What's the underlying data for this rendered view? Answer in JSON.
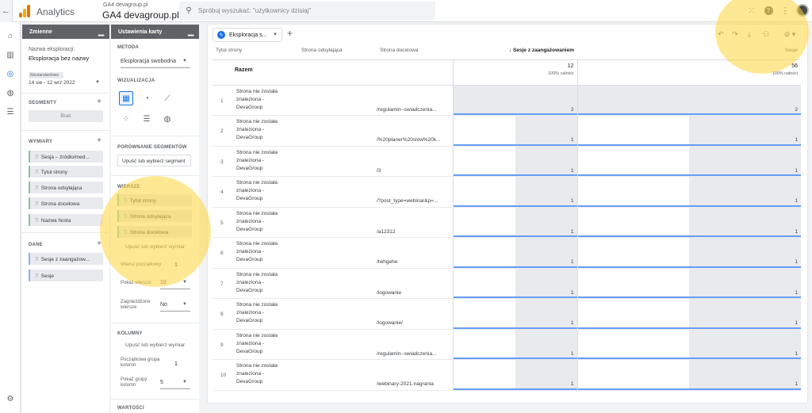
{
  "topbar": {
    "app_name": "Analytics",
    "property_small": "GA4 devagroup.pl",
    "property_big": "GA4 devagroup.pl",
    "search_placeholder": "Spróbuj wyszukać: \"użytkownicy dzisiaj\"",
    "icons": [
      "apps-grid-icon",
      "help-icon",
      "more-vert-icon",
      "avatar"
    ]
  },
  "rail": [
    "home-icon",
    "reports-icon",
    "explore-icon",
    "advertising-icon",
    "configure-icon",
    "settings-icon"
  ],
  "variables": {
    "header": "Zmienne",
    "name_label": "Nazwa eksploracji:",
    "name_value": "Eksploracja bez nazwy",
    "date_custom": "Niestandardowe",
    "date_range": "14 sie - 12 wrz 2022",
    "segments_title": "SEGMENTY",
    "segments_empty": "Brak",
    "dimensions_title": "WYMIARY",
    "dimensions": [
      "Sesja – źródło/med...",
      "Tytuł strony",
      "Strona odsyłająca",
      "Strona docelowa",
      "Nazwa hosta"
    ],
    "metrics_title": "DANE",
    "metrics": [
      "Sesje z zaangażow...",
      "Sesje"
    ]
  },
  "settings": {
    "header": "Ustawienia karty",
    "technique_title": "METODA",
    "technique_value": "Eksploracja swobodna",
    "vis_title": "WIZUALIZACJA",
    "segment_compare_title": "PORÓWNANIE SEGMENTÓW",
    "segment_drop": "Upuść lub wybierz segment",
    "rows_title": "WIERSZE",
    "rows": [
      "Tytuł strony",
      "Strona odsyłająca",
      "Strona docelowa"
    ],
    "rows_drop": "Upuść lub wybierz wymiar",
    "start_row_label": "Wiersz początkowy",
    "start_row_value": "1",
    "show_rows_label": "Pokaż wiersze",
    "show_rows_value": "10",
    "nested_rows_label": "Zagnieżdżone wiersze",
    "nested_rows_value": "No",
    "columns_title": "KOLUMNY",
    "columns_drop": "Upuść lub wybierz wymiar",
    "start_col_label": "Początkowa grupa kolumn",
    "start_col_value": "1",
    "show_cols_label": "Pokaż grupy kolumn",
    "show_cols_value": "5",
    "values_title": "WARTOŚCI"
  },
  "canvas": {
    "tab_label": "Eksploracja s...",
    "headers": [
      "Tytuł strony",
      "Strona odsyłająca",
      "Strona docelowa",
      "↓ Sesje z zaangażowaniem",
      "Sesje"
    ],
    "totals_label": "Razem",
    "totals": [
      {
        "value": "12",
        "pct": "100% całości"
      },
      {
        "value": "56",
        "pct": "100% całości"
      }
    ],
    "rows": [
      {
        "n": "1",
        "title": [
          "Strona nie została",
          "znaleziona -",
          "DevaGroup"
        ],
        "landing": "/regulamin--swiadczenia...",
        "engaged": "2",
        "sessions": "2",
        "engaged_frac": 1,
        "sessions_frac": 1
      },
      {
        "n": "2",
        "title": [
          "Strona nie została",
          "znaleziona -",
          "DevaGroup"
        ],
        "landing": "/%20planer%20slow%20k...",
        "engaged": "1",
        "sessions": "1",
        "engaged_frac": 0.5,
        "sessions_frac": 0.5
      },
      {
        "n": "3",
        "title": [
          "Strona nie została",
          "znaleziona -",
          "DevaGroup"
        ],
        "landing": "/3",
        "engaged": "1",
        "sessions": "1",
        "engaged_frac": 0.5,
        "sessions_frac": 0.5
      },
      {
        "n": "4",
        "title": [
          "Strona nie została",
          "znaleziona -",
          "DevaGroup"
        ],
        "landing": "/?post_type=webinar&p=...",
        "engaged": "1",
        "sessions": "1",
        "engaged_frac": 0.5,
        "sessions_frac": 0.5
      },
      {
        "n": "5",
        "title": [
          "Strona nie została",
          "znaleziona -",
          "DevaGroup"
        ],
        "landing": "/a12312",
        "engaged": "1",
        "sessions": "1",
        "engaged_frac": 0.5,
        "sessions_frac": 0.5
      },
      {
        "n": "6",
        "title": [
          "Strona nie została",
          "znaleziona -",
          "DevaGroup"
        ],
        "landing": "/twhgehe",
        "engaged": "1",
        "sessions": "1",
        "engaged_frac": 0.5,
        "sessions_frac": 0.5
      },
      {
        "n": "7",
        "title": [
          "Strona nie została",
          "znaleziona -",
          "DevaGroup"
        ],
        "landing": "/logowanie",
        "engaged": "1",
        "sessions": "1",
        "engaged_frac": 0.5,
        "sessions_frac": 0.5
      },
      {
        "n": "8",
        "title": [
          "Strona nie została",
          "znaleziona -",
          "DevaGroup"
        ],
        "landing": "/logowanie/",
        "engaged": "1",
        "sessions": "1",
        "engaged_frac": 0.5,
        "sessions_frac": 0.5
      },
      {
        "n": "9",
        "title": [
          "Strona nie została",
          "znaleziona -",
          "DevaGroup"
        ],
        "landing": "/regulamin--swiadczenia...",
        "engaged": "1",
        "sessions": "1",
        "engaged_frac": 0.5,
        "sessions_frac": 0.5
      },
      {
        "n": "10",
        "title": [
          "Strona nie została",
          "znaleziona -",
          "DevaGroup"
        ],
        "landing": "/webinary-2021-nagrania",
        "engaged": "1",
        "sessions": "1",
        "engaged_frac": 0.5,
        "sessions_frac": 0.5
      }
    ]
  },
  "colors": {
    "accent": "#1a73e8",
    "highlight": "#ffd63c",
    "header_dark": "#5f6368"
  }
}
